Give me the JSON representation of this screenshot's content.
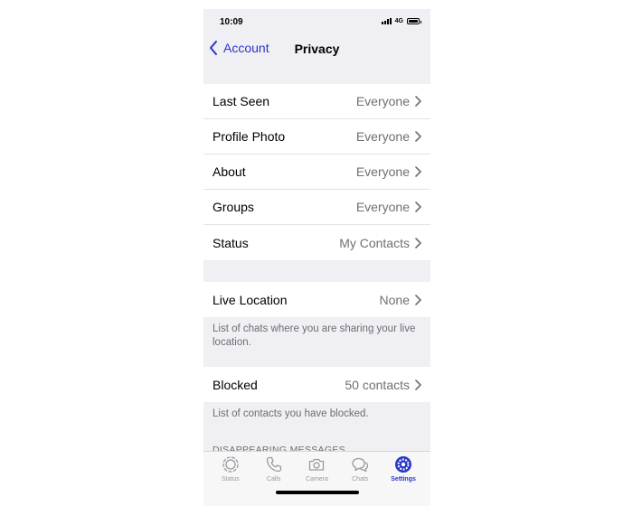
{
  "status_bar": {
    "time": "10:09",
    "network": "4G"
  },
  "nav": {
    "back_label": "Account",
    "title": "Privacy"
  },
  "privacy_items": [
    {
      "label": "Last Seen",
      "value": "Everyone"
    },
    {
      "label": "Profile Photo",
      "value": "Everyone"
    },
    {
      "label": "About",
      "value": "Everyone"
    },
    {
      "label": "Groups",
      "value": "Everyone"
    },
    {
      "label": "Status",
      "value": "My Contacts"
    }
  ],
  "live_location": {
    "label": "Live Location",
    "value": "None",
    "footnote": "List of chats where you are sharing your live location."
  },
  "blocked": {
    "label": "Blocked",
    "value": "50 contacts",
    "footnote": "List of contacts you have blocked."
  },
  "disappearing_header": "DISAPPEARING MESSAGES",
  "tabs": [
    {
      "label": "Status",
      "icon": "status-icon",
      "active": false
    },
    {
      "label": "Calls",
      "icon": "phone-icon",
      "active": false
    },
    {
      "label": "Camera",
      "icon": "camera-icon",
      "active": false
    },
    {
      "label": "Chats",
      "icon": "chats-icon",
      "active": false
    },
    {
      "label": "Settings",
      "icon": "settings-icon",
      "active": true
    }
  ],
  "colors": {
    "accent": "#2a36c7",
    "grouped_background": "#efeff4",
    "secondary_text": "#707070",
    "tab_inactive": "#9a9a9f"
  }
}
